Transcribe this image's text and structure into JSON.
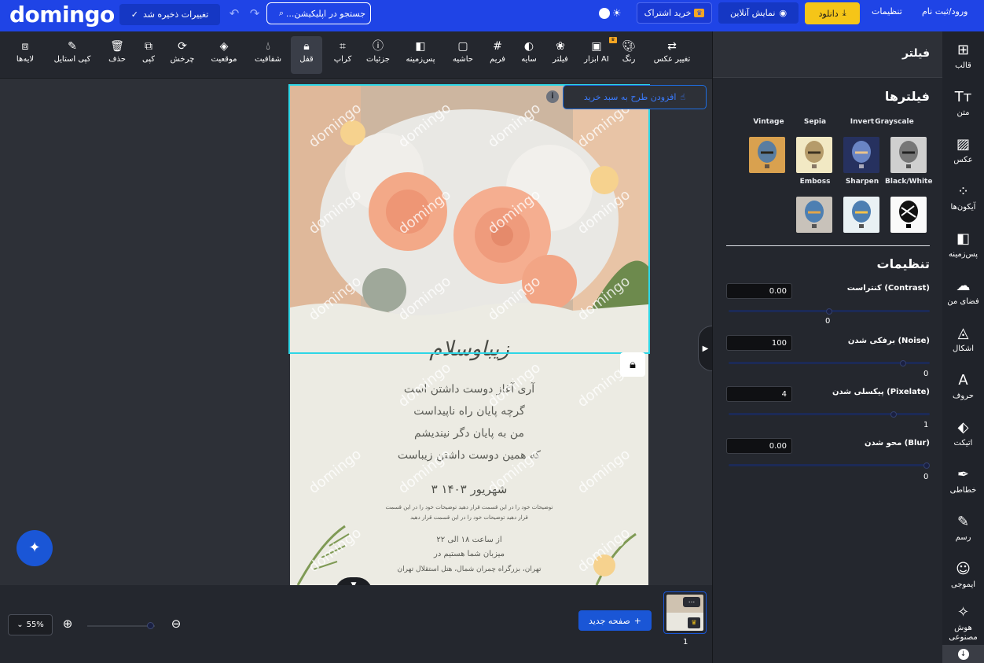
{
  "app": {
    "logo": "domingo"
  },
  "topbar": {
    "saved_label": "تغییرات ذخیره شد",
    "search_placeholder": "جستجو در اپلیکیشن...",
    "subscribe_label": "خرید اشتراک",
    "online_label": "نمایش آنلاین",
    "download_label": "دانلود",
    "settings_label": "تنظیمات",
    "login_label": "ورود/ثبت نام"
  },
  "sidebar": {
    "items": [
      {
        "label": "قالب",
        "icon": "layout-icon"
      },
      {
        "label": "متن",
        "icon": "text-icon"
      },
      {
        "label": "عکس",
        "icon": "image-icon"
      },
      {
        "label": "آیکون‌ها",
        "icon": "icons-grid-icon"
      },
      {
        "label": "پس‌زمینه",
        "icon": "background-icon"
      },
      {
        "label": "فضای من",
        "icon": "cloud-upload-icon"
      },
      {
        "label": "اشکال",
        "icon": "shapes-icon"
      },
      {
        "label": "حروف",
        "icon": "letters-icon"
      },
      {
        "label": "اتیکت",
        "icon": "tag-icon"
      },
      {
        "label": "خطاطی",
        "icon": "feather-icon"
      },
      {
        "label": "رسم",
        "icon": "pencil-icon"
      },
      {
        "label": "ایموجی",
        "icon": "emoji-icon"
      },
      {
        "label": "هوش مصنوعی",
        "icon": "ai-magic-icon"
      }
    ]
  },
  "panel": {
    "title": "فیلتر",
    "filters_heading": "فیلترها",
    "filters": [
      {
        "label": "Grayscale"
      },
      {
        "label": "Invert"
      },
      {
        "label": "Sepia"
      },
      {
        "label": "Vintage"
      },
      {
        "label": "Black/White"
      },
      {
        "label": "Sharpen"
      },
      {
        "label": "Emboss"
      }
    ],
    "settings_heading": "تنظیمات",
    "settings": [
      {
        "label": "کنتراست (Contrast)",
        "value": "0.00",
        "slider_value": "0",
        "level": 0.5
      },
      {
        "label": "برفکی شدن (Noise)",
        "value": "100",
        "slider_value": "0",
        "level": 0.88
      },
      {
        "label": "پیکسلی شدن (Pixelate)",
        "value": "4",
        "slider_value": "1",
        "level": 0.83
      },
      {
        "label": "محو شدن (Blur)",
        "value": "0.00",
        "slider_value": "0",
        "level": 1.0
      }
    ]
  },
  "toolbar": {
    "tools": [
      {
        "label": "تغییر عکس",
        "icon": "swap-image-icon"
      },
      {
        "label": "رنگ",
        "icon": "palette-icon"
      },
      {
        "label": "ابزار AI",
        "icon": "ai-tools-icon"
      },
      {
        "label": "فیلتر",
        "icon": "filter-icon"
      },
      {
        "label": "سایه",
        "icon": "shadow-icon"
      },
      {
        "label": "فریم",
        "icon": "frame-icon"
      },
      {
        "label": "حاشیه",
        "icon": "border-icon"
      },
      {
        "label": "پس‌زمینه",
        "icon": "background-icon"
      },
      {
        "label": "جزئیات",
        "icon": "info-icon"
      },
      {
        "label": "کراپ",
        "icon": "crop-icon"
      },
      {
        "label": "قفل",
        "icon": "lock-icon"
      },
      {
        "label": "شفافیت",
        "icon": "opacity-icon"
      },
      {
        "label": "موقعیت",
        "icon": "layers-position-icon"
      },
      {
        "label": "چرخش",
        "icon": "rotate-icon"
      },
      {
        "label": "کپی",
        "icon": "copy-icon"
      },
      {
        "label": "حذف",
        "icon": "trash-icon"
      },
      {
        "label": "کپی استایل",
        "icon": "copy-style-icon"
      },
      {
        "label": "لایه‌ها",
        "icon": "layers-icon"
      }
    ]
  },
  "canvas": {
    "add_to_cart_label": "افزودن طرح به سبد خرید",
    "watermark": "domingo",
    "invitation": {
      "title": "زیباوسلام",
      "poem": [
        "آری آغاز دوست داشتن است",
        "گرچه پایان راه ناپیداست",
        "من به پایان دگر نیندیشم",
        "که همین دوست داشتن زیباست"
      ],
      "date": "۳ شهریور ۱۴۰۳",
      "desc": [
        "توضیحات خود را در این قسمت قرار دهید توضیحات خود را در این قسمت",
        "قرار دهید توضیحات خود را در این قسمت قرار دهید"
      ],
      "time": "از ساعت ۱۸ الی ۲۲",
      "host": "میزبان شما هستیم در",
      "venue": "تهران، بزرگراه چمران شمال، هتل استقلال تهران"
    }
  },
  "bottombar": {
    "zoom": "55%",
    "new_page_label": "صفحه جدید",
    "page_number": "1",
    "page_menu": "..."
  },
  "colors": {
    "brand_blue": "#1f44e6",
    "download_yellow": "#f5c518",
    "selection_cyan": "#2ed6e6",
    "panel_dark": "#24272e"
  }
}
